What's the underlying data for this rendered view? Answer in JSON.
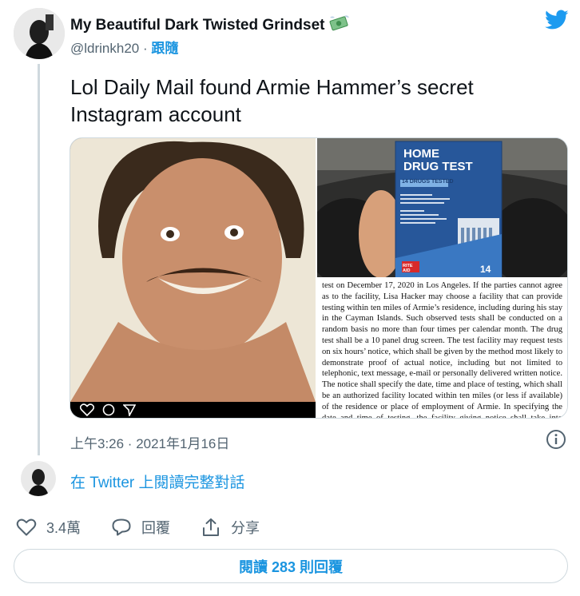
{
  "author": {
    "display_name": "My Beautiful Dark Twisted Grindset",
    "handle": "@ldrinkh20",
    "separator": "·",
    "follow_label": "跟隨",
    "name_emoji_icon": "money-with-wings-icon"
  },
  "brand_icon": "twitter-bird-icon",
  "tweet": {
    "text": "Lol Daily Mail found Armie Hammer’s secret Instagram account"
  },
  "media": {
    "left_image": "selfie-photo",
    "right_top_image": "home-drug-test-box-photo",
    "box": {
      "brand_line1": "HOME",
      "brand_line2": "DRUG TEST",
      "subtitle": "14 DRUGS TESTED",
      "count": "14",
      "store": "RITE AID"
    },
    "document_text": "test on December 17, 2020 in Los Angeles.  If the parties cannot agree as to the facility, Lisa Hacker may choose a facility that can provide testing within ten miles of Armie’s residence, including during his stay in the Cayman Islands. Such observed tests shall be conducted on a random basis no more than four times per calendar month. The drug test shall be a 10 panel drug screen. The test facility may request tests on six hours’ notice, which shall be given by the method most likely to demonstrate proof of actual notice, including but not limited to telephonic, text message, e-mail or personally delivered written notice. The notice shall specify the date, time and place of testing, which shall be an authorized facility located within ten miles (or less if available) of the residence or place of employment of Armie. In specifying the date and time of testing, the facility giving notice shall take into account"
  },
  "timestamp": "上午3:26 · 2021年1月16日",
  "thread_link": "在 Twitter 上閱讀完整對話",
  "actions": {
    "like_count": "3.4萬",
    "reply_label": "回覆",
    "share_label": "分享"
  },
  "read_replies_label": "閱讀 283 則回覆",
  "colors": {
    "accent": "#1b95e0",
    "muted_text": "#536471",
    "border": "#cfd9de",
    "twitter_blue": "#1d9bf0"
  }
}
